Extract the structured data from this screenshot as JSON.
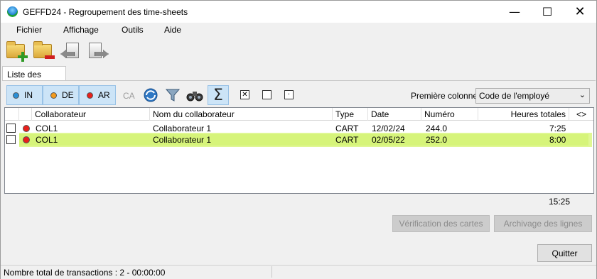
{
  "window": {
    "title": "GEFFD24 - Regroupement des time-sheets",
    "min": "—",
    "max": "☐",
    "close": "✕"
  },
  "menu": [
    "Fichier",
    "Affichage",
    "Outils",
    "Aide"
  ],
  "tabs": {
    "active": "Liste des cartes"
  },
  "filters": {
    "in": {
      "label": "IN",
      "color": "#2a8fd6"
    },
    "de": {
      "label": "DE",
      "color": "#f39a1c"
    },
    "ar": {
      "label": "AR",
      "color": "#e8201c"
    },
    "ca": "CA"
  },
  "tools": {
    "sigma": "Σ",
    "check_x": "☒",
    "check_empty": "☐",
    "check_dot": "⊡"
  },
  "first_column": {
    "label": "Première colonne",
    "value": "Code de l'employé"
  },
  "table": {
    "headers": [
      "Collaborateur",
      "Nom du collaborateur",
      "Type",
      "Date",
      "Numéro",
      "Heures totales",
      "<>"
    ],
    "rows": [
      {
        "code": "COL1",
        "name": "Collaborateur 1",
        "type": "CART",
        "date": "12/02/24",
        "numero": "244.0",
        "heures": "7:25",
        "status_color": "#e8201c",
        "selected": false
      },
      {
        "code": "COL1",
        "name": "Collaborateur 1",
        "type": "CART",
        "date": "02/05/22",
        "numero": "252.0",
        "heures": "8:00",
        "status_color": "#e8201c",
        "selected": true
      }
    ],
    "total": "15:25"
  },
  "buttons": {
    "verify": "Vérification des cartes",
    "archive": "Archivage des lignes",
    "quit": "Quitter"
  },
  "status": "Nombre total de transactions : 2 - 00:00:00"
}
